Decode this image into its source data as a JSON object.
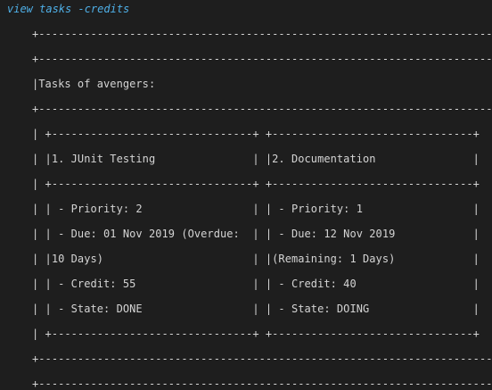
{
  "command": "view tasks -credits",
  "output_lines": [
    "+-----------------------------------------------------------------------+",
    "+-----------------------------------------------------------------------+",
    "|Tasks of avengers:                                                     |",
    "+-----------------------------------------------------------------------+",
    "| +-------------------------------+ +-------------------------------+  |",
    "| |1. JUnit Testing               | |2. Documentation               |  |",
    "| +-------------------------------+ +-------------------------------+  |",
    "| | - Priority: 2                 | | - Priority: 1                 |  |",
    "| | - Due: 01 Nov 2019 (Overdue:  | | - Due: 12 Nov 2019            |  |",
    "| |10 Days)                       | |(Remaining: 1 Days)            |  |",
    "| | - Credit: 55                  | | - Credit: 40                  |  |",
    "| | - State: DONE                 | | - State: DOING                |  |",
    "| +-------------------------------+ +-------------------------------+  |",
    "+-----------------------------------------------------------------------+",
    "+-----------------------------------------------------------------------+"
  ]
}
